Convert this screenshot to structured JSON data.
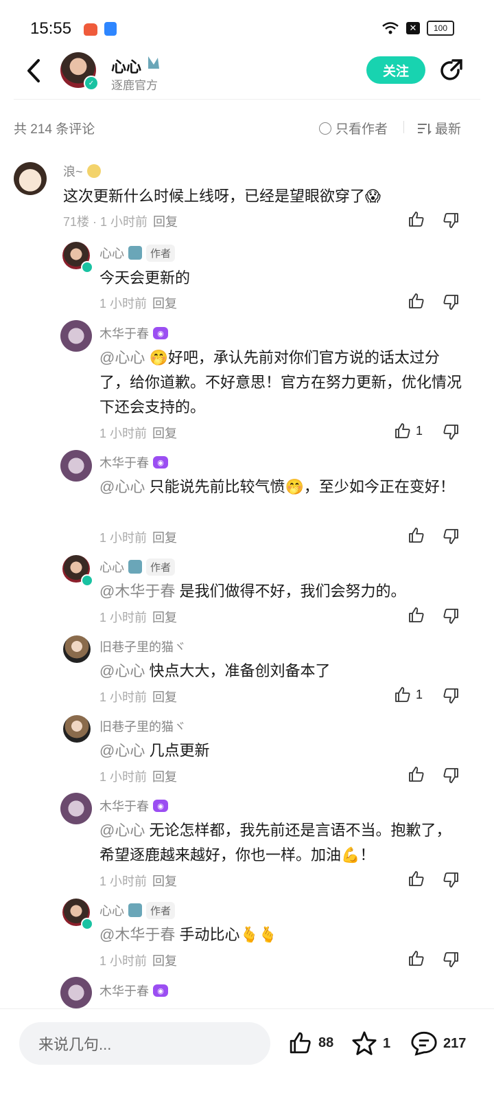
{
  "status_bar": {
    "time": "15:55",
    "battery": "100"
  },
  "header": {
    "name": "心心",
    "subtitle": "逐鹿官方",
    "follow_label": "关注"
  },
  "toolbar": {
    "count_text": "共 214 条评论",
    "only_author": "只看作者",
    "sort": "最新"
  },
  "comments": [
    {
      "name": "浪~",
      "text": "这次更新什么时候上线呀，已经是望眼欲穿了",
      "emoji": "😱",
      "meta": "71楼 · 1 小时前",
      "reply": "回复"
    },
    {
      "name": "心心",
      "tag": "作者",
      "text": "今天会更新的",
      "meta": "1 小时前",
      "reply": "回复"
    },
    {
      "name": "木华于春",
      "at": "@心心",
      "text": "好吧，承认先前对你们官方说的话太过分了，给你道歉。不好意思！官方在努力更新，优化情况下还会支持的。",
      "emoji": "🤭",
      "meta": "1 小时前",
      "reply": "回复",
      "likes": "1"
    },
    {
      "name": "木华于春",
      "at": "@心心",
      "text": "只能说先前比较气愤",
      "emoji": "🤭",
      "text2": "，至少如今正在变好！",
      "meta": "1 小时前",
      "reply": "回复"
    },
    {
      "name": "心心",
      "tag": "作者",
      "at": "@木华于春",
      "text": "是我们做得不好，我们会努力的。",
      "meta": "1 小时前",
      "reply": "回复"
    },
    {
      "name": "旧巷子里的猫ヾ",
      "at": "@心心",
      "text": "快点大大，准备创刘备本了",
      "meta": "1 小时前",
      "reply": "回复",
      "likes": "1"
    },
    {
      "name": "旧巷子里的猫ヾ",
      "at": "@心心",
      "text": "几点更新",
      "meta": "1 小时前",
      "reply": "回复"
    },
    {
      "name": "木华于春",
      "at": "@心心",
      "text": "无论怎样都，我先前还是言语不当。抱歉了，希望逐鹿越来越好，你也一样。加油",
      "emoji": "💪",
      "text2": "！",
      "meta": "1 小时前",
      "reply": "回复"
    },
    {
      "name": "心心",
      "tag": "作者",
      "at": "@木华于春",
      "text": "手动比心",
      "emoji": "🫰🫰",
      "meta": "1 小时前",
      "reply": "回复"
    },
    {
      "name": "木华于春"
    }
  ],
  "bottom_bar": {
    "placeholder": "来说几句...",
    "likes": "88",
    "stars": "1",
    "comments": "217"
  },
  "icons": [
    "back-arrow-icon",
    "share-icon",
    "thumb-up-icon",
    "thumb-down-icon",
    "star-icon",
    "comment-icon",
    "wifi-icon",
    "verified-icon",
    "game-badge-icon"
  ],
  "colors": {
    "accent": "#18d3b0",
    "badge_purple": "#9b4ef2",
    "verify": "#19c2a2"
  }
}
